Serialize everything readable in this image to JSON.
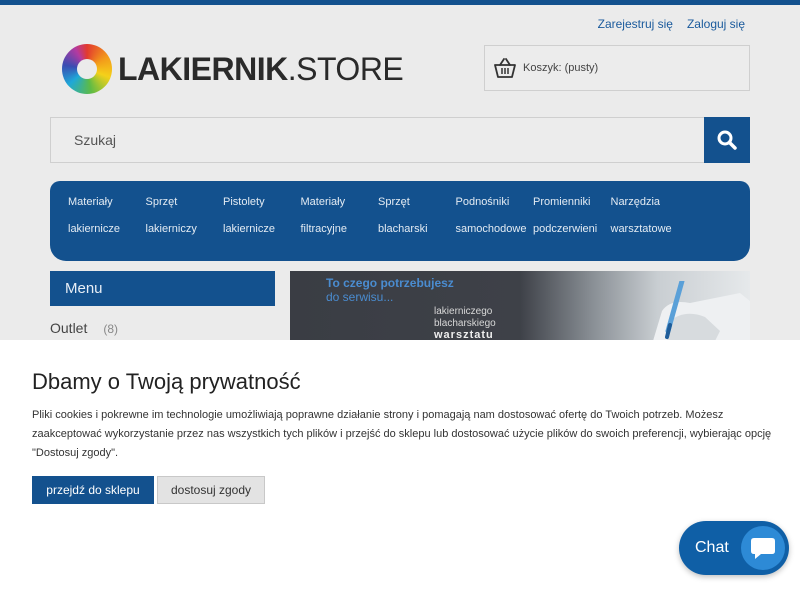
{
  "header": {
    "register_link": "Zarejestruj się",
    "login_link": "Zaloguj się",
    "logo_bold": "LAKIERNIK",
    "logo_rest": ".STORE",
    "cart_label": "Koszyk: (pusty)"
  },
  "search": {
    "placeholder": "Szukaj"
  },
  "nav": {
    "items": [
      {
        "line1": "Materiały",
        "line2": "lakiernicze"
      },
      {
        "line1": "Sprzęt",
        "line2": "lakierniczy"
      },
      {
        "line1": "Pistolety",
        "line2": "lakiernicze"
      },
      {
        "line1": "Materiały",
        "line2": "filtracyjne"
      },
      {
        "line1": "Sprzęt",
        "line2": "blacharski"
      },
      {
        "line1": "Podnośniki",
        "line2": "samochodowe"
      },
      {
        "line1": "Promienniki",
        "line2": "podczerwieni"
      },
      {
        "line1": "Narzędzia",
        "line2": "warsztatowe"
      }
    ]
  },
  "sidebar": {
    "heading": "Menu",
    "items": [
      {
        "label": "Outlet",
        "count": "(8)"
      }
    ]
  },
  "banner": {
    "line1": "To czego potrzebujesz",
    "line2": "do serwisu...",
    "line3": "lakierniczego",
    "line4": "blacharskiego",
    "line5": "warsztatu"
  },
  "consent": {
    "title": "Dbamy o Twoją prywatność",
    "text": "Pliki cookies i pokrewne im technologie umożliwiają poprawne działanie strony i pomagają nam dostosować ofertę do Twoich potrzeb. Możesz zaakceptować wykorzystanie przez nas wszystkich tych plików i przejść do sklepu lub dostosować użycie plików do swoich preferencji, wybierając opcję \"Dostosuj zgody\".",
    "accept_button": "przejdź do sklepu",
    "customize_button": "dostosuj zgody"
  },
  "chat": {
    "label": "Chat"
  },
  "colors": {
    "brand": "#13518e",
    "page_bg": "#ebebeb",
    "chat": "#0f5fa6"
  },
  "icons": [
    "basket-icon",
    "search-icon",
    "chat-bubble-icon",
    "logo-ring-icon"
  ]
}
